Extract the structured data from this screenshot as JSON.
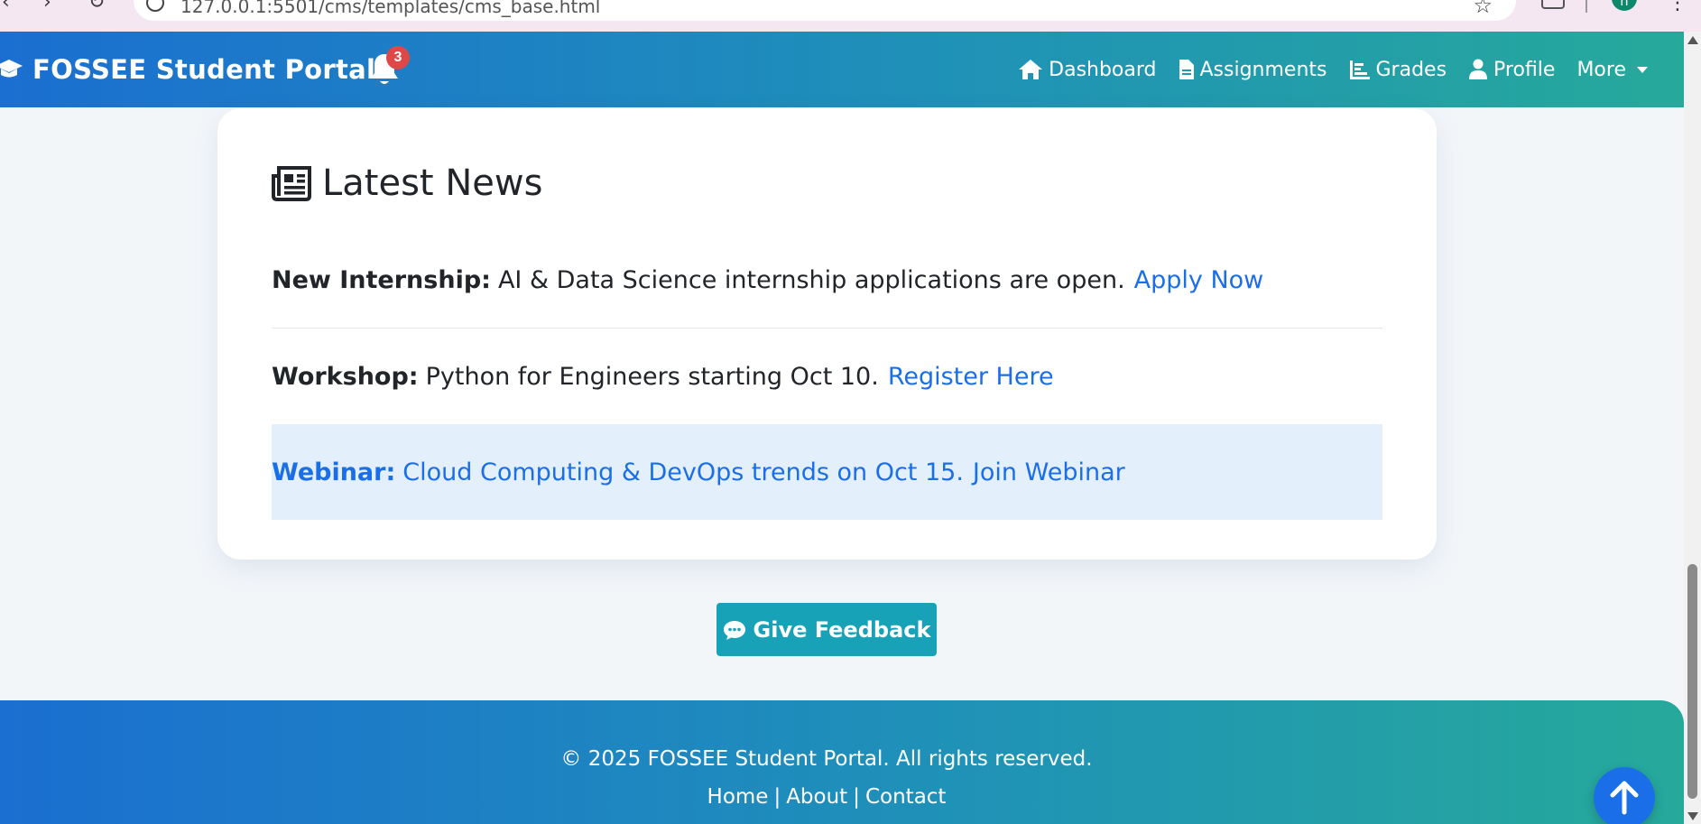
{
  "browser": {
    "url": "127.0.0.1:5501/cms/templates/cms_base.html",
    "profile_initial": "n"
  },
  "navbar": {
    "brand": "FOSSEE Student Portal",
    "notification_count": "3",
    "links": [
      {
        "label": "Dashboard",
        "icon": "home-icon"
      },
      {
        "label": "Assignments",
        "icon": "document-icon"
      },
      {
        "label": "Grades",
        "icon": "chart-icon"
      },
      {
        "label": "Profile",
        "icon": "user-icon"
      },
      {
        "label": "More",
        "icon": "caret-down-icon"
      }
    ]
  },
  "news": {
    "title": "Latest News",
    "items": [
      {
        "label": "New Internship:",
        "text": "AI & Data Science internship applications are open.",
        "link": "Apply Now"
      },
      {
        "label": "Workshop:",
        "text": "Python for Engineers starting Oct 10.",
        "link": "Register Here"
      },
      {
        "label": "Webinar:",
        "text": "Cloud Computing & DevOps trends on Oct 15.",
        "link": "Join Webinar"
      }
    ]
  },
  "feedback": {
    "label": "Give Feedback"
  },
  "footer": {
    "copyright": "© 2025 FOSSEE Student Portal. All rights reserved.",
    "links": [
      "Home",
      "About",
      "Contact"
    ]
  },
  "colors": {
    "brand_gradient_start": "#1b6fd0",
    "brand_gradient_end": "#26a99b",
    "link": "#1a6fe8",
    "feedback_button": "#17a2b8",
    "badge": "#e04848",
    "highlight_row": "#e3f0fc"
  }
}
